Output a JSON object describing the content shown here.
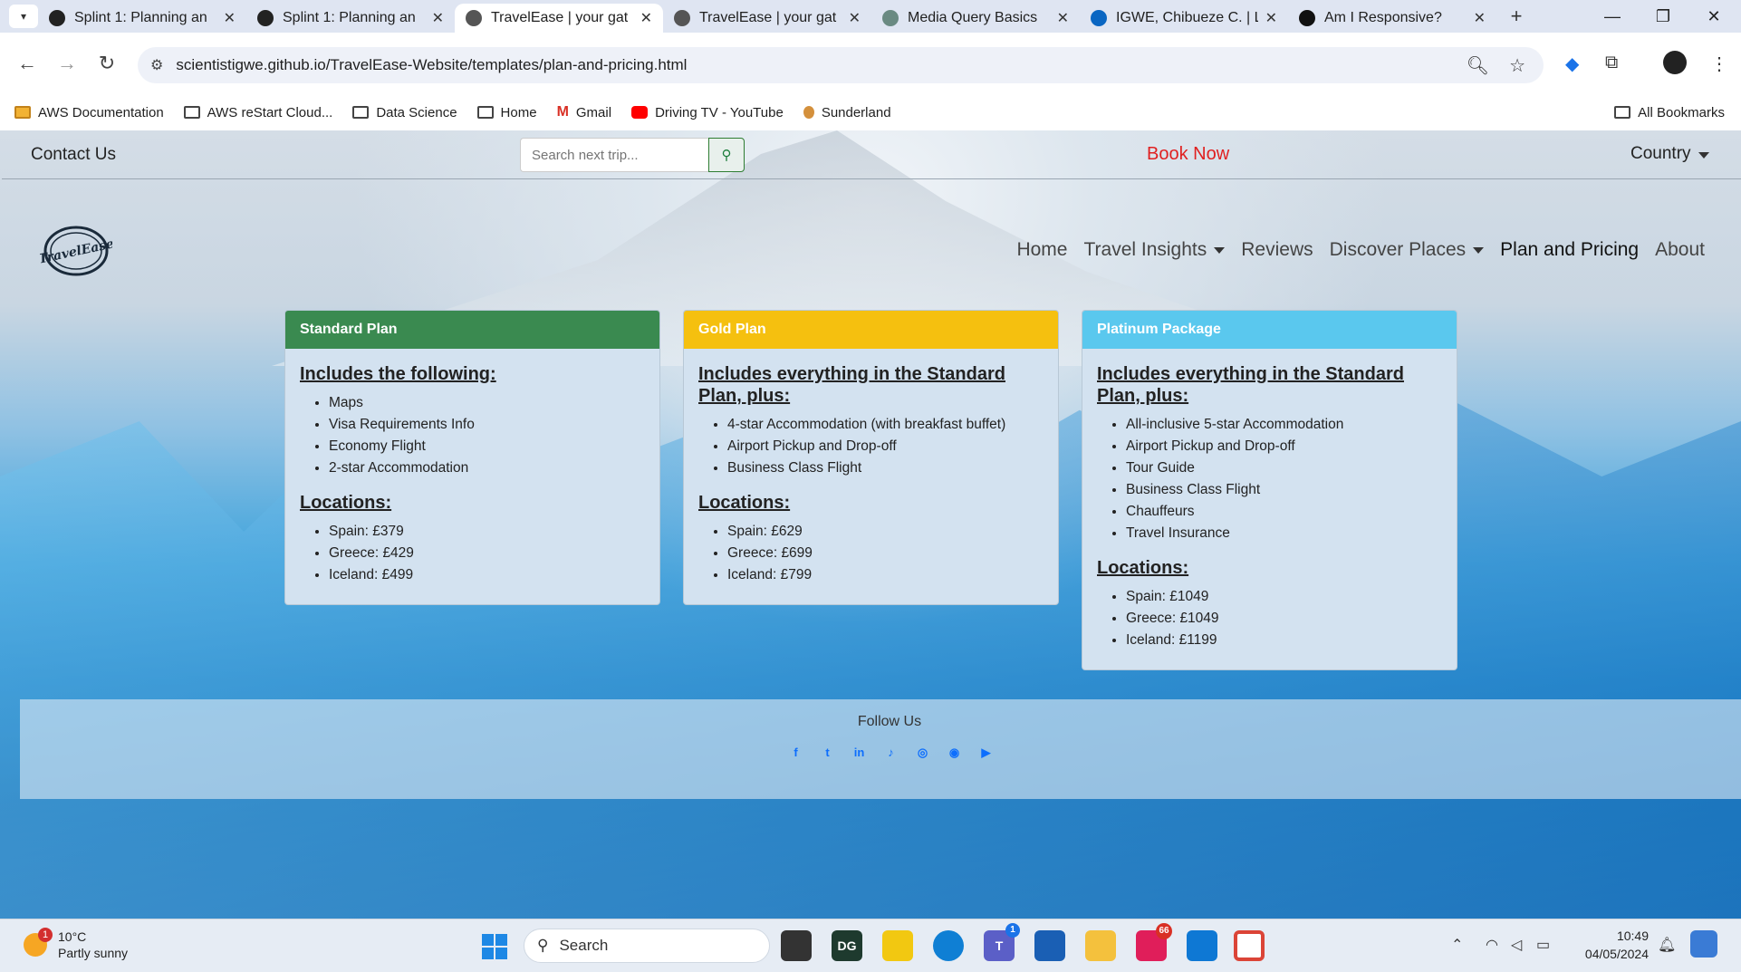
{
  "browser": {
    "tabs": [
      {
        "title": "Splint 1: Planning an",
        "icon": "github-icon",
        "color": "#222222"
      },
      {
        "title": "Splint 1: Planning an",
        "icon": "github-icon",
        "color": "#222222"
      },
      {
        "title": "TravelEase | your gat",
        "icon": "globe-icon",
        "color": "#555555",
        "active": true
      },
      {
        "title": "TravelEase | your gat",
        "icon": "globe-icon",
        "color": "#555555"
      },
      {
        "title": "Media Query Basics",
        "icon": "openai-icon",
        "color": "#6a8a82"
      },
      {
        "title": "IGWE, Chibueze C. | L",
        "icon": "linkedin-icon",
        "color": "#0a66c2"
      },
      {
        "title": "Am I Responsive?",
        "icon": "responsive-icon",
        "color": "#111111"
      }
    ],
    "url": "scientistigwe.github.io/TravelEase-Website/templates/plan-and-pricing.html",
    "bookmarks": [
      {
        "label": "AWS Documentation",
        "icon": "aws-icon"
      },
      {
        "label": "AWS reStart Cloud...",
        "icon": "folder-icon"
      },
      {
        "label": "Data Science",
        "icon": "folder-icon"
      },
      {
        "label": "Home",
        "icon": "folder-icon"
      },
      {
        "label": "Gmail",
        "icon": "gmail-icon"
      },
      {
        "label": "Driving TV - YouTube",
        "icon": "youtube-icon"
      },
      {
        "label": "Sunderland",
        "icon": "sunderland-icon"
      }
    ],
    "all_bookmarks": "All Bookmarks"
  },
  "site": {
    "contact": "Contact Us",
    "search_placeholder": "Search next trip...",
    "book_now": "Book Now",
    "country": "Country",
    "logo_text": "TravelEase",
    "nav": [
      {
        "label": "Home",
        "dropdown": false
      },
      {
        "label": "Travel Insights",
        "dropdown": true
      },
      {
        "label": "Reviews",
        "dropdown": false
      },
      {
        "label": "Discover Places",
        "dropdown": true
      },
      {
        "label": "Plan and Pricing",
        "dropdown": false,
        "active": true
      },
      {
        "label": "About",
        "dropdown": false
      }
    ],
    "plans": [
      {
        "name": "Standard Plan",
        "color": "#3a8a50",
        "heading": "Includes the following:",
        "features": [
          "Maps",
          "Visa Requirements Info",
          "Economy Flight",
          "2-star Accommodation"
        ],
        "locations_heading": "Locations:",
        "locations": [
          "Spain: £379",
          "Greece: £429",
          "Iceland: £499"
        ]
      },
      {
        "name": "Gold Plan",
        "color": "#f5c00f",
        "heading": "Includes everything in the Standard Plan, plus:",
        "features": [
          "4-star Accommodation (with breakfast buffet)",
          "Airport Pickup and Drop-off",
          "Business Class Flight"
        ],
        "locations_heading": "Locations:",
        "locations": [
          "Spain: £629",
          "Greece: £699",
          "Iceland: £799"
        ]
      },
      {
        "name": "Platinum Package",
        "color": "#5ac8ee",
        "heading": "Includes everything in the Standard Plan, plus:",
        "features": [
          "All-inclusive 5-star Accommodation",
          "Airport Pickup and Drop-off",
          "Tour Guide",
          "Business Class Flight",
          "Chauffeurs",
          "Travel Insurance"
        ],
        "locations_heading": "Locations:",
        "locations": [
          "Spain: £1049",
          "Greece: £1049",
          "Iceland: £1199"
        ]
      }
    ],
    "footer": {
      "follow": "Follow Us",
      "socials": [
        "facebook-icon",
        "twitter-icon",
        "linkedin-icon",
        "tiktok-icon",
        "instagram-icon",
        "github-icon",
        "youtube-icon"
      ]
    }
  },
  "taskbar": {
    "temperature": "10°C",
    "weather": "Partly sunny",
    "weather_badge": "1",
    "search": "Search",
    "time": "10:49",
    "date": "04/05/2024",
    "teams_badge": "1",
    "slack_badge": "66"
  }
}
